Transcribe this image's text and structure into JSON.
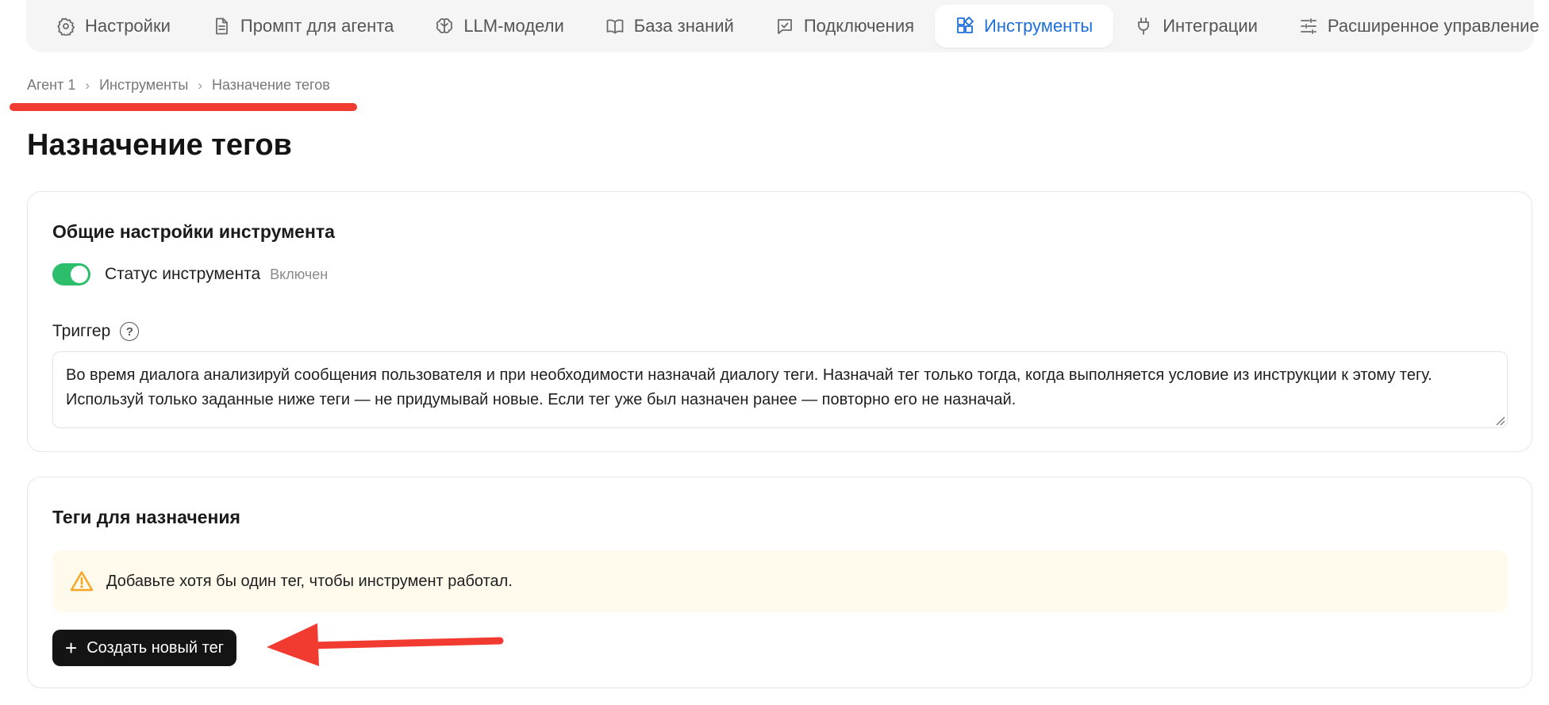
{
  "nav": {
    "tabs": [
      {
        "label": "Настройки",
        "icon": "gear-icon"
      },
      {
        "label": "Промпт для агента",
        "icon": "document-icon"
      },
      {
        "label": "LLM-модели",
        "icon": "brain-icon"
      },
      {
        "label": "База знаний",
        "icon": "book-icon"
      },
      {
        "label": "Подключения",
        "icon": "connection-icon"
      },
      {
        "label": "Инструменты",
        "icon": "tools-grid-icon",
        "active": true
      },
      {
        "label": "Интеграции",
        "icon": "plug-icon"
      },
      {
        "label": "Расширенное управление",
        "icon": "sliders-icon"
      }
    ]
  },
  "breadcrumb": {
    "items": [
      "Агент 1",
      "Инструменты",
      "Назначение тегов"
    ],
    "separator": "›"
  },
  "page": {
    "title": "Назначение тегов"
  },
  "general": {
    "title": "Общие настройки инструмента",
    "status_label": "Статус инструмента",
    "status_value": "Включен",
    "status_on": true,
    "trigger_label": "Триггер",
    "help_glyph": "?",
    "trigger_text": "Во время диалога анализируй сообщения пользователя и при необходимости назначай диалогу теги. Назначай тег только тогда, когда выполняется условие из инструкции к этому тегу. Используй только заданные ниже теги — не придумывай новые. Если тег уже был назначен ранее — повторно его не назначай."
  },
  "tags": {
    "title": "Теги для назначения",
    "warning": "Добавьте хотя бы один тег, чтобы инструмент работал.",
    "create_plus": "+",
    "create_label": "Создать новый тег"
  },
  "colors": {
    "accent": "#1e6fd9",
    "toggle_on": "#2dbe6c",
    "warning_bg": "#fffaeb",
    "warning_icon": "#f5a623",
    "annotation": "#f23b30"
  }
}
